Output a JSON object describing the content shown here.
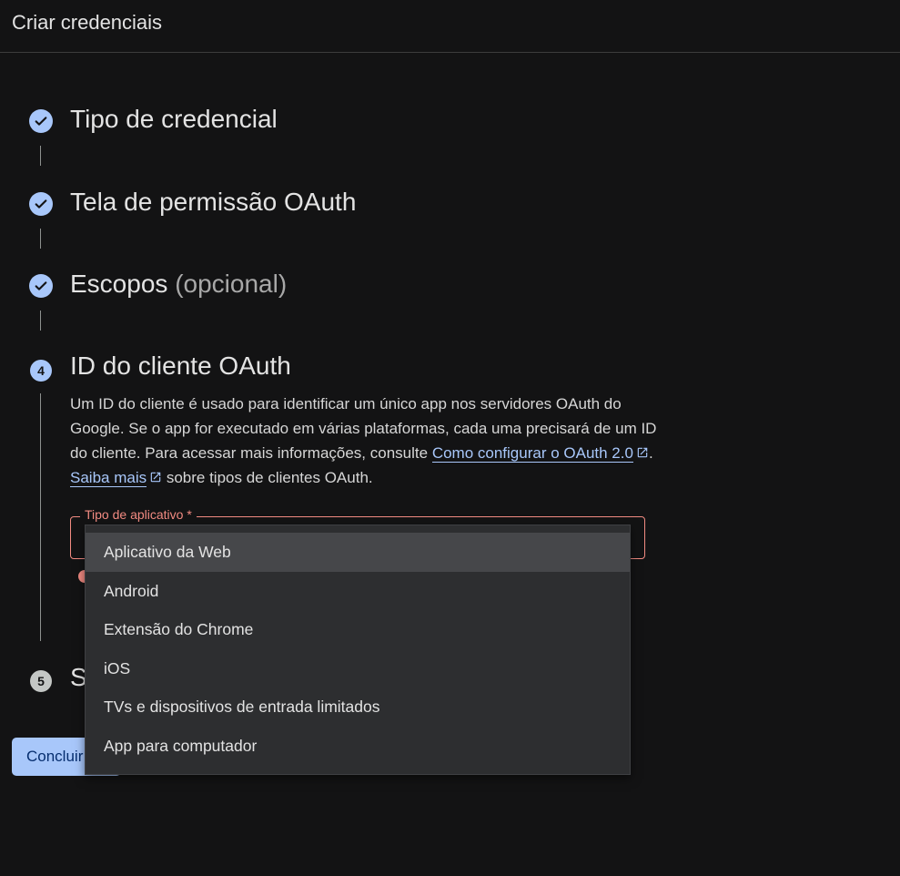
{
  "header": {
    "title": "Criar credenciais"
  },
  "steps": [
    {
      "title": "Tipo de credencial",
      "status": "done"
    },
    {
      "title": "Tela de permissão OAuth",
      "status": "done"
    },
    {
      "title": "Escopos",
      "optional": "(opcional)",
      "status": "done"
    },
    {
      "number": "4",
      "title": "ID do cliente OAuth",
      "status": "active"
    },
    {
      "number": "5",
      "title": "S",
      "status": "inactive"
    }
  ],
  "description": {
    "text1": "Um ID do cliente é usado para identificar um único app nos servidores OAuth do Google. Se o app for executado em várias plataformas, cada uma precisará de um ID do cliente. Para acessar mais informações, consulte ",
    "link1": "Como configurar o OAuth 2.0",
    "text2": ". ",
    "link2": "Saiba mais",
    "text3": " sobre tipos de clientes OAuth."
  },
  "app_type_field": {
    "label": "Tipo de aplicativo *",
    "options": [
      "Aplicativo da Web",
      "Android",
      "Extensão do Chrome",
      "iOS",
      "TVs e dispositivos de entrada limitados",
      "App para computador"
    ],
    "highlighted": "Aplicativo da Web"
  },
  "done_button": {
    "label": "Concluir"
  },
  "colors": {
    "background": "#131314",
    "accent": "#a8c7fa",
    "error": "#f28b82",
    "menu_bg": "#2d2e30"
  }
}
